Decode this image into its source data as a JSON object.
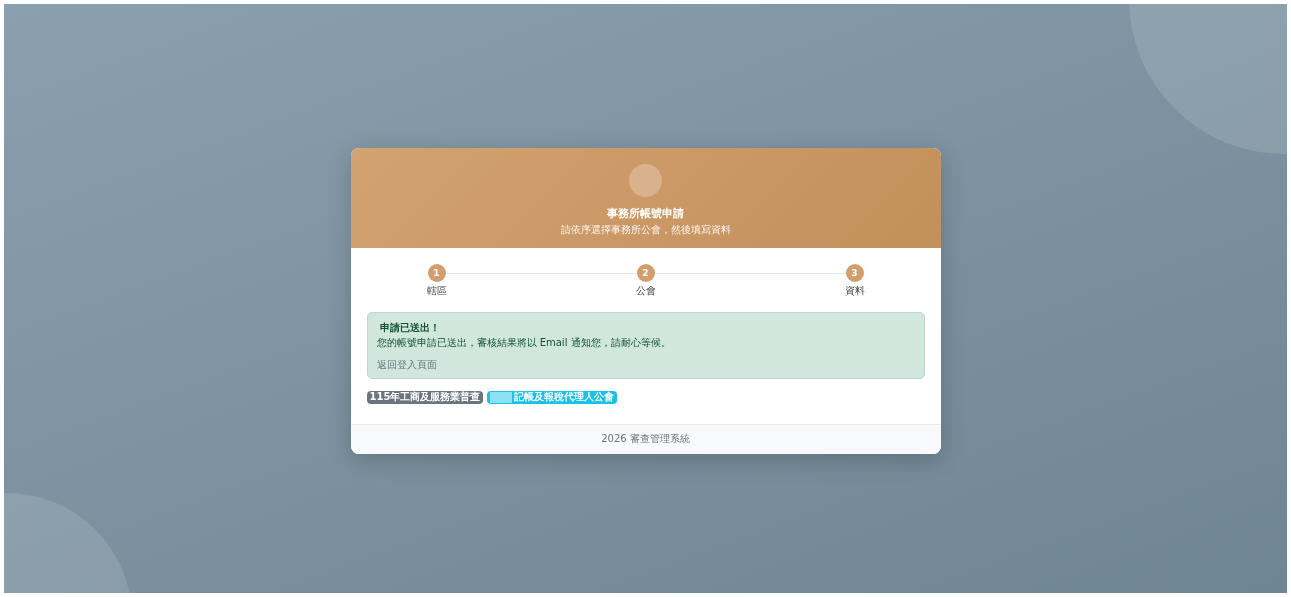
{
  "header": {
    "title": "事務所帳號申請",
    "subtitle": "請依序選擇事務所公會，然後填寫資料"
  },
  "steps": [
    {
      "number": "1",
      "label": "轄區"
    },
    {
      "number": "2",
      "label": "公會"
    },
    {
      "number": "3",
      "label": "資料"
    }
  ],
  "alert": {
    "title": "申請已送出！",
    "message": "您的帳號申請已送出，審核結果將以 Email 通知您，請耐心等候。",
    "link": "返回登入頁面"
  },
  "badges": [
    {
      "label": "115年工商及服務業普查",
      "color": "#6c757d",
      "redacted": false
    },
    {
      "label": "記帳及報稅代理人公會",
      "color": "#17c1e8",
      "redacted": true
    }
  ],
  "footer": "2026 審查管理系統"
}
